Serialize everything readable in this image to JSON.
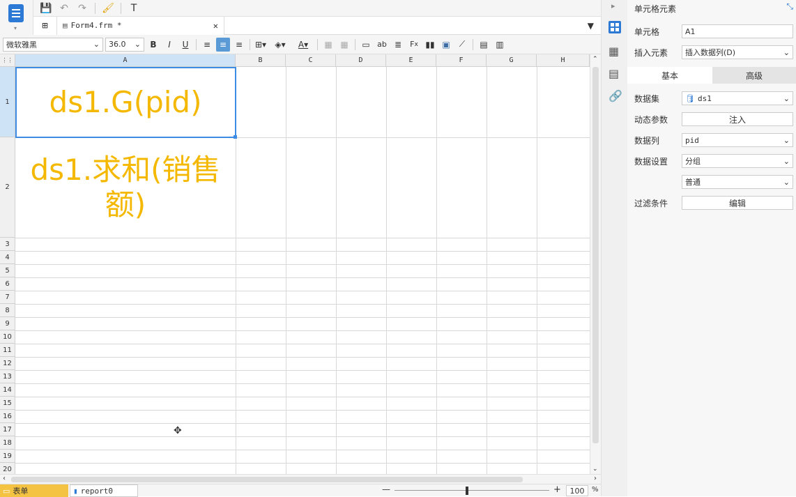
{
  "toolbar": {
    "file_tab": "Form4.frm *"
  },
  "format": {
    "font": "微软雅黑",
    "size": "36.0"
  },
  "columns": [
    "A",
    "B",
    "C",
    "D",
    "E",
    "F",
    "G",
    "H"
  ],
  "rows": [
    "1",
    "2",
    "3",
    "4",
    "5",
    "6",
    "7",
    "8",
    "9",
    "10",
    "11",
    "12",
    "13",
    "14",
    "15",
    "16",
    "17",
    "18",
    "19",
    "20"
  ],
  "cells": {
    "a1": "ds1.G(pid)",
    "a2_line1": "ds1.求和(销售",
    "a2_line2": "额)"
  },
  "status": {
    "sheet1": "表单",
    "sheet2": "report0",
    "zoom": "100",
    "zoom_unit": "%"
  },
  "panel": {
    "title": "单元格元素",
    "cell_label": "单元格",
    "cell_value": "A1",
    "insert_label": "插入元素",
    "insert_value": "插入数据列(D)",
    "tab_basic": "基本",
    "tab_advanced": "高级",
    "dataset_label": "数据集",
    "dataset_value": "ds1",
    "param_label": "动态参数",
    "param_btn": "注入",
    "column_label": "数据列",
    "column_value": "pid",
    "setting_label": "数据设置",
    "setting_value1": "分组",
    "setting_value2": "普通",
    "filter_label": "过滤条件",
    "filter_btn": "编辑"
  },
  "colors": {
    "cell_text": "#f5b800",
    "accent": "#2d7ad6",
    "selection": "#3c8ce6"
  }
}
